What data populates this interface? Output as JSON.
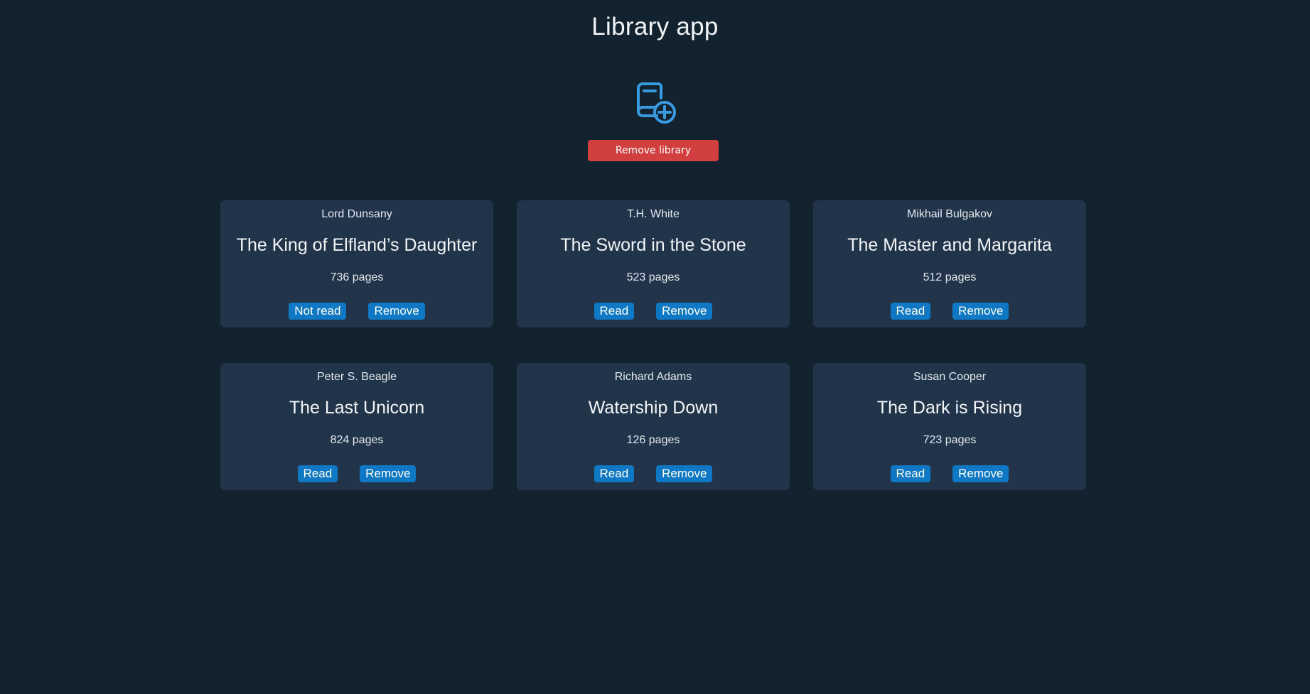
{
  "app": {
    "title": "Library app"
  },
  "toolbar": {
    "add_book_icon": "book-plus-icon",
    "remove_library_label": "Remove library"
  },
  "colors": {
    "background": "#13222f",
    "card": "#22344a",
    "accent": "#0f78c4",
    "icon": "#3a9ae0",
    "danger": "#d23f3f"
  },
  "books": [
    {
      "author": "Lord Dunsany",
      "title": "The King of Elfland’s Daughter",
      "pages": "736 pages",
      "status_label": "Not read",
      "remove_label": "Remove"
    },
    {
      "author": "T.H. White",
      "title": "The Sword in the Stone",
      "pages": "523 pages",
      "status_label": "Read",
      "remove_label": "Remove"
    },
    {
      "author": "Mikhail Bulgakov",
      "title": "The Master and Margarita",
      "pages": "512 pages",
      "status_label": "Read",
      "remove_label": "Remove"
    },
    {
      "author": "Peter S. Beagle",
      "title": "The Last Unicorn",
      "pages": "824 pages",
      "status_label": "Read",
      "remove_label": "Remove"
    },
    {
      "author": "Richard Adams",
      "title": "Watership Down",
      "pages": "126 pages",
      "status_label": "Read",
      "remove_label": "Remove"
    },
    {
      "author": "Susan Cooper",
      "title": "The Dark is Rising",
      "pages": "723 pages",
      "status_label": "Read",
      "remove_label": "Remove"
    }
  ]
}
